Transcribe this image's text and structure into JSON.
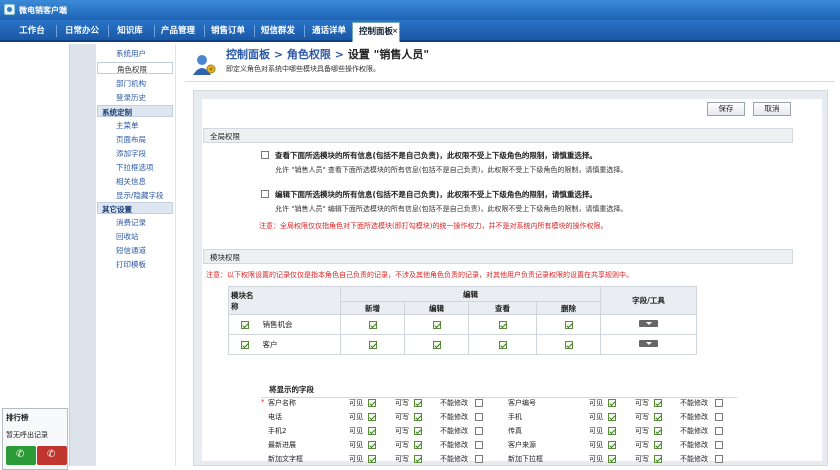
{
  "window": {
    "title": "微电销客户端"
  },
  "nav": {
    "items": [
      {
        "label": "工作台"
      },
      {
        "label": "日常办公"
      },
      {
        "label": "知识库"
      },
      {
        "label": "产品管理"
      },
      {
        "label": "销售订单"
      },
      {
        "label": "短信群发"
      },
      {
        "label": "通话详单"
      },
      {
        "label": "控制面板",
        "active": true
      }
    ],
    "close_glyph": "×"
  },
  "left_panel": {
    "rank_title": "排行榜",
    "rank_empty": "暂无呼出记录",
    "call_icon": "phone-icon",
    "hangup_icon": "hangup-icon"
  },
  "sidebar": {
    "user_items": [
      "系统用户",
      "角色权限",
      "部门机构",
      "登录历史"
    ],
    "sections": [
      {
        "title": "系统定制",
        "items": [
          "主菜单",
          "页面布局",
          "添加字段",
          "下拉框选项",
          "相关信息",
          "显示/隐藏字段"
        ]
      },
      {
        "title": "其它设置",
        "items": [
          "消费记录",
          "回收站",
          "短信通道",
          "打印模板"
        ]
      }
    ]
  },
  "header": {
    "crumb1": "控制面板",
    "crumb2": "角色权限",
    "crumb3": "设置 \"销售人员\"",
    "arrow": ">",
    "description": "即定义角色对系统中哪些模块具备哪些操作权限。"
  },
  "buttons": {
    "save": "保存",
    "cancel": "取消"
  },
  "global": {
    "title": "全局权限",
    "opt1_title": "查看下面所选模块的所有信息(包括不是自己负责)，此权限不受上下级角色的限制，请慎重选择。",
    "opt1_desc": "允许 \"销售人员\" 查看下面所选模块的所有信息(包括不是自己负责)，此权限不受上下级角色的限制，请慎重选择。",
    "opt2_title": "编辑下面所选模块的所有信息(包括不是自己负责)，此权限不受上下级角色的限制，请慎重选择。",
    "opt2_desc": "允许 \"销售人员\" 编辑下面所选模块的所有信息(包括不是自己负责)，此权限不受上下级角色的限制，请慎重选择。",
    "note": "注意：全局权限仅仅指角色对下面所选模块(即打勾模块)的统一操作权力，并不是对系统内所有模块的操作权限。"
  },
  "module": {
    "title": "模块权限",
    "note": "注意：以下权限设置的记录仅仅是指本角色自己负责的记录，不涉及其他角色负责的记录，对其他用户负责记录权限的设置在共享规则中。",
    "col_name": "模块名称",
    "col_edit": "编辑",
    "col_new": "新增",
    "col_edit2": "编辑",
    "col_view": "查看",
    "col_delete": "删除",
    "col_tools": "字段/工具",
    "rows": [
      {
        "name": "销售机会"
      },
      {
        "name": "客户"
      }
    ],
    "fields_title": "将显示的字段",
    "visible": "可见",
    "writable": "可写",
    "readonly": "不能修改",
    "fields_left": [
      "客户名称",
      "电话",
      "手机2",
      "最新进展",
      "新加文字框"
    ],
    "fields_right": [
      "客户编号",
      "手机",
      "传真",
      "客户来源",
      "新加下拉框"
    ],
    "required_mark": "*"
  },
  "colors": {
    "nav": "#1f64b4",
    "accent": "#2b59a8",
    "warn": "#dd2222"
  }
}
